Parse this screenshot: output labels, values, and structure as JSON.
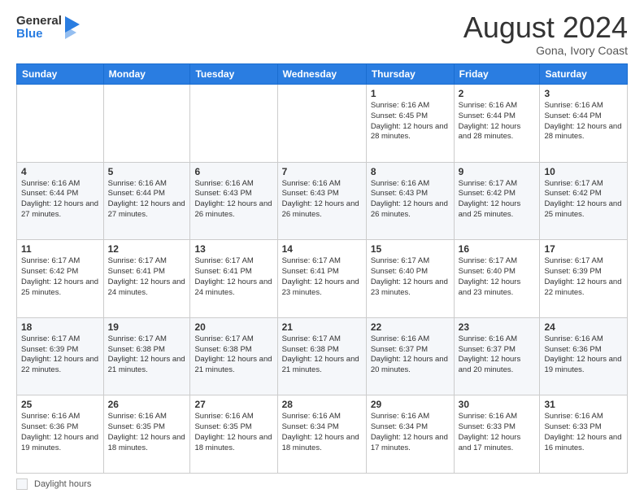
{
  "logo": {
    "line1": "General",
    "line2": "Blue"
  },
  "header": {
    "month_year": "August 2024",
    "location": "Gona, Ivory Coast"
  },
  "weekdays": [
    "Sunday",
    "Monday",
    "Tuesday",
    "Wednesday",
    "Thursday",
    "Friday",
    "Saturday"
  ],
  "weeks": [
    [
      {
        "day": "",
        "info": ""
      },
      {
        "day": "",
        "info": ""
      },
      {
        "day": "",
        "info": ""
      },
      {
        "day": "",
        "info": ""
      },
      {
        "day": "1",
        "info": "Sunrise: 6:16 AM\nSunset: 6:45 PM\nDaylight: 12 hours and 28 minutes."
      },
      {
        "day": "2",
        "info": "Sunrise: 6:16 AM\nSunset: 6:44 PM\nDaylight: 12 hours and 28 minutes."
      },
      {
        "day": "3",
        "info": "Sunrise: 6:16 AM\nSunset: 6:44 PM\nDaylight: 12 hours and 28 minutes."
      }
    ],
    [
      {
        "day": "4",
        "info": "Sunrise: 6:16 AM\nSunset: 6:44 PM\nDaylight: 12 hours and 27 minutes."
      },
      {
        "day": "5",
        "info": "Sunrise: 6:16 AM\nSunset: 6:44 PM\nDaylight: 12 hours and 27 minutes."
      },
      {
        "day": "6",
        "info": "Sunrise: 6:16 AM\nSunset: 6:43 PM\nDaylight: 12 hours and 26 minutes."
      },
      {
        "day": "7",
        "info": "Sunrise: 6:16 AM\nSunset: 6:43 PM\nDaylight: 12 hours and 26 minutes."
      },
      {
        "day": "8",
        "info": "Sunrise: 6:16 AM\nSunset: 6:43 PM\nDaylight: 12 hours and 26 minutes."
      },
      {
        "day": "9",
        "info": "Sunrise: 6:17 AM\nSunset: 6:42 PM\nDaylight: 12 hours and 25 minutes."
      },
      {
        "day": "10",
        "info": "Sunrise: 6:17 AM\nSunset: 6:42 PM\nDaylight: 12 hours and 25 minutes."
      }
    ],
    [
      {
        "day": "11",
        "info": "Sunrise: 6:17 AM\nSunset: 6:42 PM\nDaylight: 12 hours and 25 minutes."
      },
      {
        "day": "12",
        "info": "Sunrise: 6:17 AM\nSunset: 6:41 PM\nDaylight: 12 hours and 24 minutes."
      },
      {
        "day": "13",
        "info": "Sunrise: 6:17 AM\nSunset: 6:41 PM\nDaylight: 12 hours and 24 minutes."
      },
      {
        "day": "14",
        "info": "Sunrise: 6:17 AM\nSunset: 6:41 PM\nDaylight: 12 hours and 23 minutes."
      },
      {
        "day": "15",
        "info": "Sunrise: 6:17 AM\nSunset: 6:40 PM\nDaylight: 12 hours and 23 minutes."
      },
      {
        "day": "16",
        "info": "Sunrise: 6:17 AM\nSunset: 6:40 PM\nDaylight: 12 hours and 23 minutes."
      },
      {
        "day": "17",
        "info": "Sunrise: 6:17 AM\nSunset: 6:39 PM\nDaylight: 12 hours and 22 minutes."
      }
    ],
    [
      {
        "day": "18",
        "info": "Sunrise: 6:17 AM\nSunset: 6:39 PM\nDaylight: 12 hours and 22 minutes."
      },
      {
        "day": "19",
        "info": "Sunrise: 6:17 AM\nSunset: 6:38 PM\nDaylight: 12 hours and 21 minutes."
      },
      {
        "day": "20",
        "info": "Sunrise: 6:17 AM\nSunset: 6:38 PM\nDaylight: 12 hours and 21 minutes."
      },
      {
        "day": "21",
        "info": "Sunrise: 6:17 AM\nSunset: 6:38 PM\nDaylight: 12 hours and 21 minutes."
      },
      {
        "day": "22",
        "info": "Sunrise: 6:16 AM\nSunset: 6:37 PM\nDaylight: 12 hours and 20 minutes."
      },
      {
        "day": "23",
        "info": "Sunrise: 6:16 AM\nSunset: 6:37 PM\nDaylight: 12 hours and 20 minutes."
      },
      {
        "day": "24",
        "info": "Sunrise: 6:16 AM\nSunset: 6:36 PM\nDaylight: 12 hours and 19 minutes."
      }
    ],
    [
      {
        "day": "25",
        "info": "Sunrise: 6:16 AM\nSunset: 6:36 PM\nDaylight: 12 hours and 19 minutes."
      },
      {
        "day": "26",
        "info": "Sunrise: 6:16 AM\nSunset: 6:35 PM\nDaylight: 12 hours and 18 minutes."
      },
      {
        "day": "27",
        "info": "Sunrise: 6:16 AM\nSunset: 6:35 PM\nDaylight: 12 hours and 18 minutes."
      },
      {
        "day": "28",
        "info": "Sunrise: 6:16 AM\nSunset: 6:34 PM\nDaylight: 12 hours and 18 minutes."
      },
      {
        "day": "29",
        "info": "Sunrise: 6:16 AM\nSunset: 6:34 PM\nDaylight: 12 hours and 17 minutes."
      },
      {
        "day": "30",
        "info": "Sunrise: 6:16 AM\nSunset: 6:33 PM\nDaylight: 12 hours and 17 minutes."
      },
      {
        "day": "31",
        "info": "Sunrise: 6:16 AM\nSunset: 6:33 PM\nDaylight: 12 hours and 16 minutes."
      }
    ]
  ],
  "footer": {
    "daylight_label": "Daylight hours"
  }
}
